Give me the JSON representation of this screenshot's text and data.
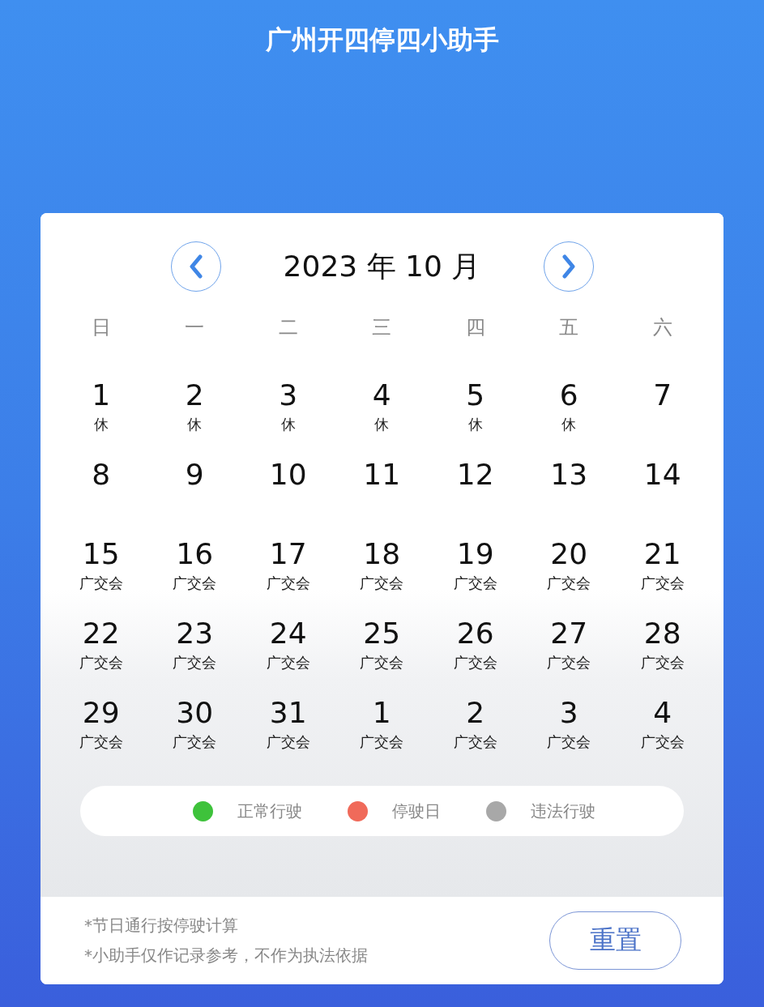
{
  "header": {
    "title": "广州开四停四小助手"
  },
  "calendar": {
    "month_title": "2023 年 10 月",
    "weekdays": [
      "日",
      "一",
      "二",
      "三",
      "四",
      "五",
      "六"
    ],
    "days": [
      {
        "day": "1",
        "note": "休"
      },
      {
        "day": "2",
        "note": "休"
      },
      {
        "day": "3",
        "note": "休"
      },
      {
        "day": "4",
        "note": "休"
      },
      {
        "day": "5",
        "note": "休"
      },
      {
        "day": "6",
        "note": "休"
      },
      {
        "day": "7"
      },
      {
        "day": "8"
      },
      {
        "day": "9"
      },
      {
        "day": "10"
      },
      {
        "day": "11"
      },
      {
        "day": "12"
      },
      {
        "day": "13"
      },
      {
        "day": "14"
      },
      {
        "day": "15",
        "note": "广交会"
      },
      {
        "day": "16",
        "note": "广交会"
      },
      {
        "day": "17",
        "note": "广交会"
      },
      {
        "day": "18",
        "note": "广交会"
      },
      {
        "day": "19",
        "note": "广交会"
      },
      {
        "day": "20",
        "note": "广交会"
      },
      {
        "day": "21",
        "note": "广交会"
      },
      {
        "day": "22",
        "note": "广交会"
      },
      {
        "day": "23",
        "note": "广交会"
      },
      {
        "day": "24",
        "note": "广交会"
      },
      {
        "day": "25",
        "note": "广交会"
      },
      {
        "day": "26",
        "note": "广交会"
      },
      {
        "day": "27",
        "note": "广交会"
      },
      {
        "day": "28",
        "note": "广交会"
      },
      {
        "day": "29",
        "note": "广交会"
      },
      {
        "day": "30",
        "note": "广交会"
      },
      {
        "day": "31",
        "note": "广交会"
      },
      {
        "day": "1",
        "note": "广交会"
      },
      {
        "day": "2",
        "note": "广交会"
      },
      {
        "day": "3",
        "note": "广交会"
      },
      {
        "day": "4",
        "note": "广交会"
      }
    ]
  },
  "legend": [
    {
      "label": "正常行驶",
      "color": "#3ec23b"
    },
    {
      "label": "停驶日",
      "color": "#f06a5a"
    },
    {
      "label": "违法行驶",
      "color": "#a8a8a8"
    }
  ],
  "footer": {
    "notes": [
      "*节日通行按停驶计算",
      "*小助手仅作记录参考，不作为执法依据"
    ],
    "reset_button": "重置"
  }
}
